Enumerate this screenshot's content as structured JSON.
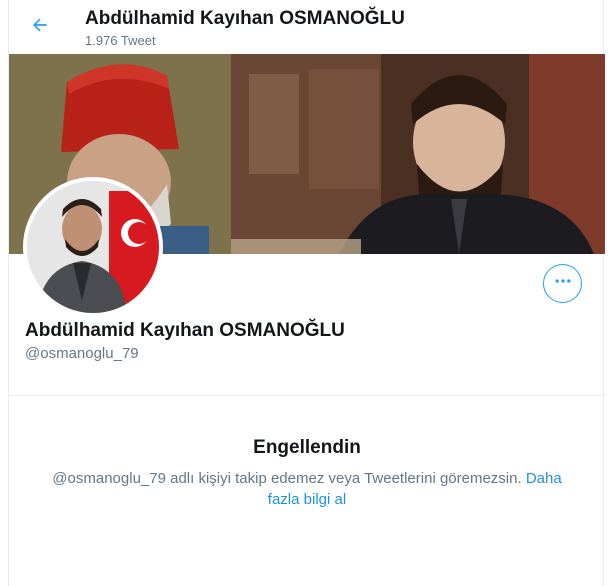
{
  "header": {
    "name": "Abdülhamid Kayıhan OSMANOĞLU",
    "tweet_count": "1.976 Tweet"
  },
  "profile": {
    "name": "Abdülhamid Kayıhan OSMANOĞLU",
    "handle": "@osmanoglu_79"
  },
  "blocked": {
    "title": "Engellendin",
    "message": "@osmanoglu_79 adlı kişiyi takip edemez veya Tweetlerini göremezsin.",
    "learn_more": "Daha fazla bilgi al"
  },
  "icons": {
    "back": "arrow-left-icon",
    "more": "more-dots-icon"
  },
  "colors": {
    "accent": "#1da1f2",
    "link": "#1b95e0",
    "secondary_text": "#657786",
    "border": "#e6ecf0"
  }
}
